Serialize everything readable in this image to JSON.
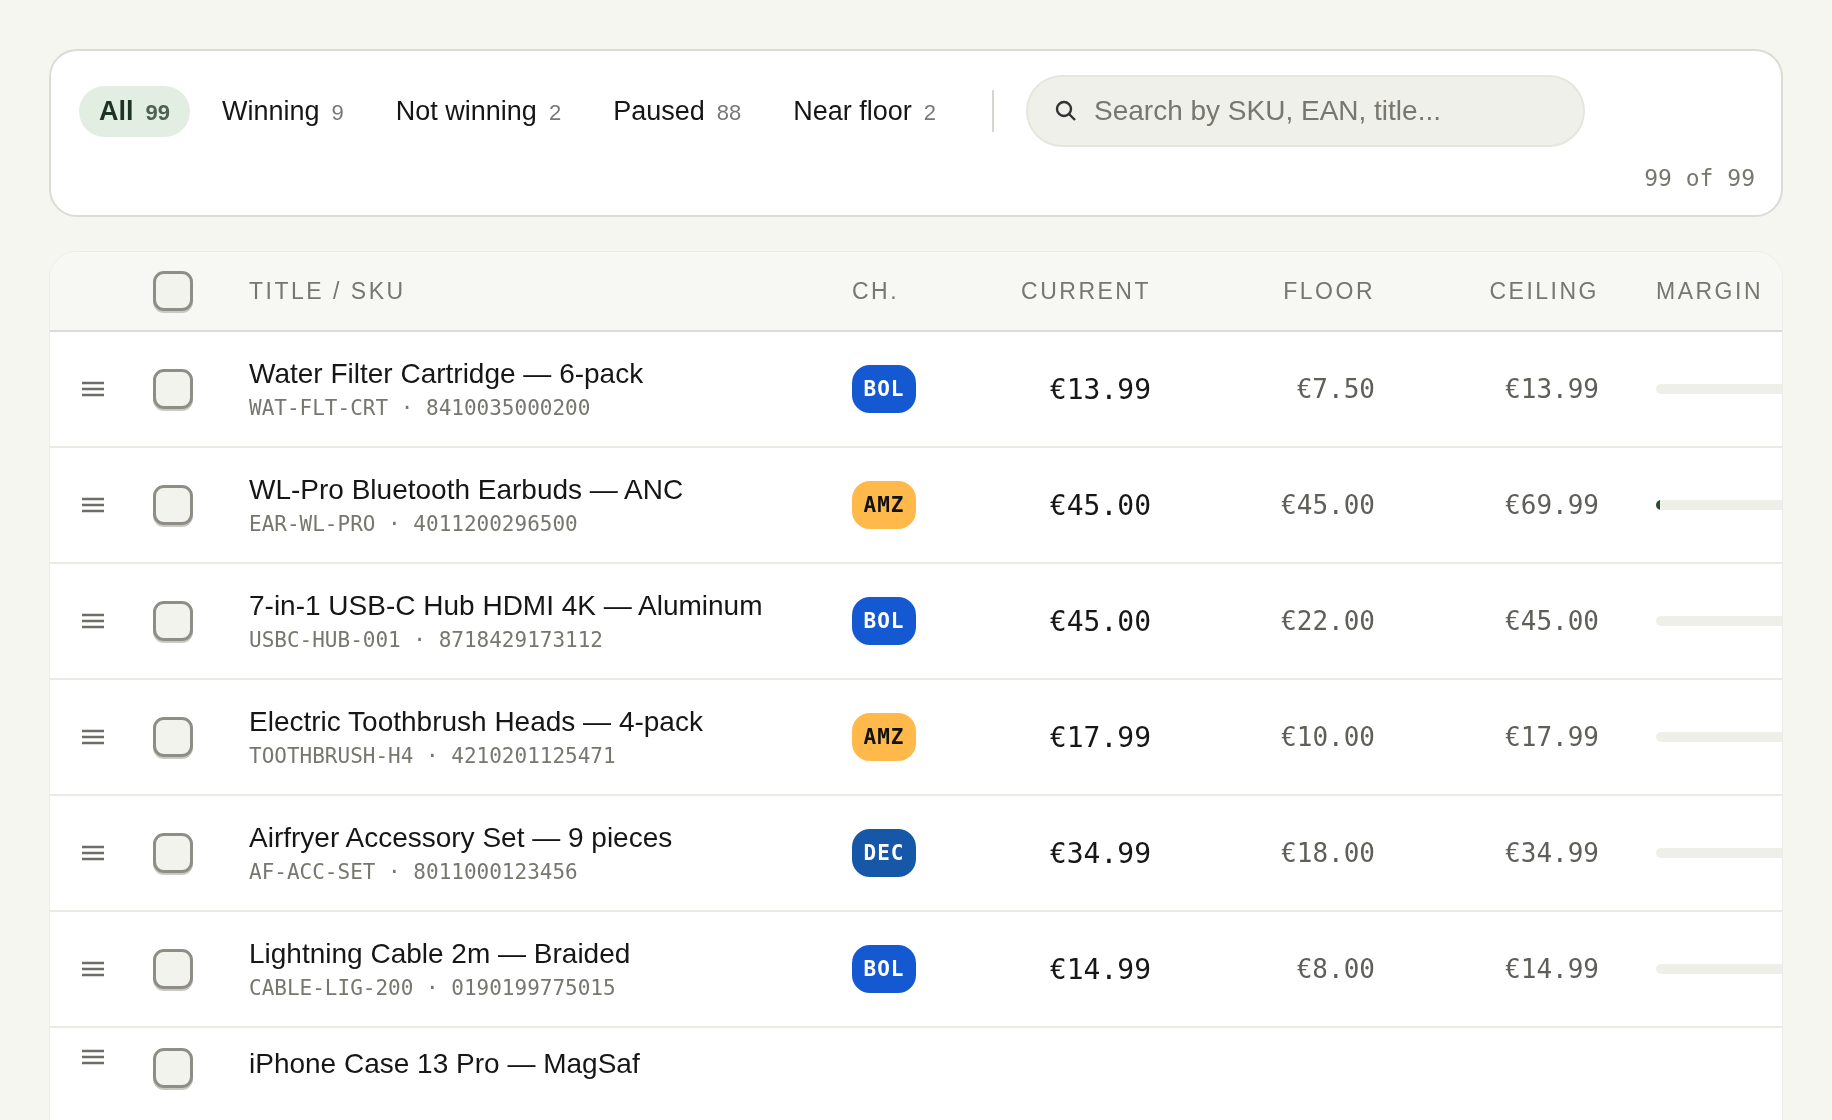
{
  "filters": {
    "tabs": [
      {
        "label": "All",
        "count": "99",
        "selected": true
      },
      {
        "label": "Winning",
        "count": "9",
        "selected": false
      },
      {
        "label": "Not winning",
        "count": "2",
        "selected": false
      },
      {
        "label": "Paused",
        "count": "88",
        "selected": false
      },
      {
        "label": "Near floor",
        "count": "2",
        "selected": false
      }
    ],
    "search": {
      "placeholder": "Search by SKU, EAN, title..."
    },
    "result_count": "99 of 99"
  },
  "table": {
    "select_all": {
      "checked": false
    },
    "columns": [
      "TITLE / SKU",
      "CH.",
      "CURRENT",
      "FLOOR",
      "CEILING",
      "MARGIN"
    ],
    "rows": [
      {
        "title": "Water Filter Cartridge — 6-pack",
        "sku_ean": "WAT-FLT-CRT · 8410035000200",
        "channel": {
          "label": "BOL",
          "color": "#1459d1"
        },
        "current": "€13.99",
        "floor": "€7.50",
        "ceiling": "€13.99",
        "margin": {
          "level": 0
        },
        "checked": false
      },
      {
        "title": "WL-Pro Bluetooth Earbuds — ANC",
        "sku_ean": "EAR-WL-PRO · 4011200296500",
        "channel": {
          "label": "AMZ",
          "color": "#ffb84a"
        },
        "current": "€45.00",
        "floor": "€45.00",
        "ceiling": "€69.99",
        "margin": {
          "level": 0.02
        },
        "checked": false
      },
      {
        "title": "7-in-1 USB-C Hub HDMI 4K — Aluminum",
        "sku_ean": "USBC-HUB-001 · 8718429173112",
        "channel": {
          "label": "BOL",
          "color": "#1459d1"
        },
        "current": "€45.00",
        "floor": "€22.00",
        "ceiling": "€45.00",
        "margin": {
          "level": 0
        },
        "checked": false
      },
      {
        "title": "Electric Toothbrush Heads — 4-pack",
        "sku_ean": "TOOTHBRUSH-H4 · 4210201125471",
        "channel": {
          "label": "AMZ",
          "color": "#ffb84a"
        },
        "current": "€17.99",
        "floor": "€10.00",
        "ceiling": "€17.99",
        "margin": {
          "level": 0
        },
        "checked": false
      },
      {
        "title": "Airfryer Accessory Set — 9 pieces",
        "sku_ean": "AF-ACC-SET · 8011000123456",
        "channel": {
          "label": "DEC",
          "color": "#1657a8"
        },
        "current": "€34.99",
        "floor": "€18.00",
        "ceiling": "€34.99",
        "margin": {
          "level": 0
        },
        "checked": false
      },
      {
        "title": "Lightning Cable 2m — Braided",
        "sku_ean": "CABLE-LIG-200 · 0190199775015",
        "channel": {
          "label": "BOL",
          "color": "#1459d1"
        },
        "current": "€14.99",
        "floor": "€8.00",
        "ceiling": "€14.99",
        "margin": {
          "level": 0
        },
        "checked": false
      },
      {
        "title": "iPhone Case 13 Pro — MagSaf",
        "checked": false
      }
    ]
  }
}
